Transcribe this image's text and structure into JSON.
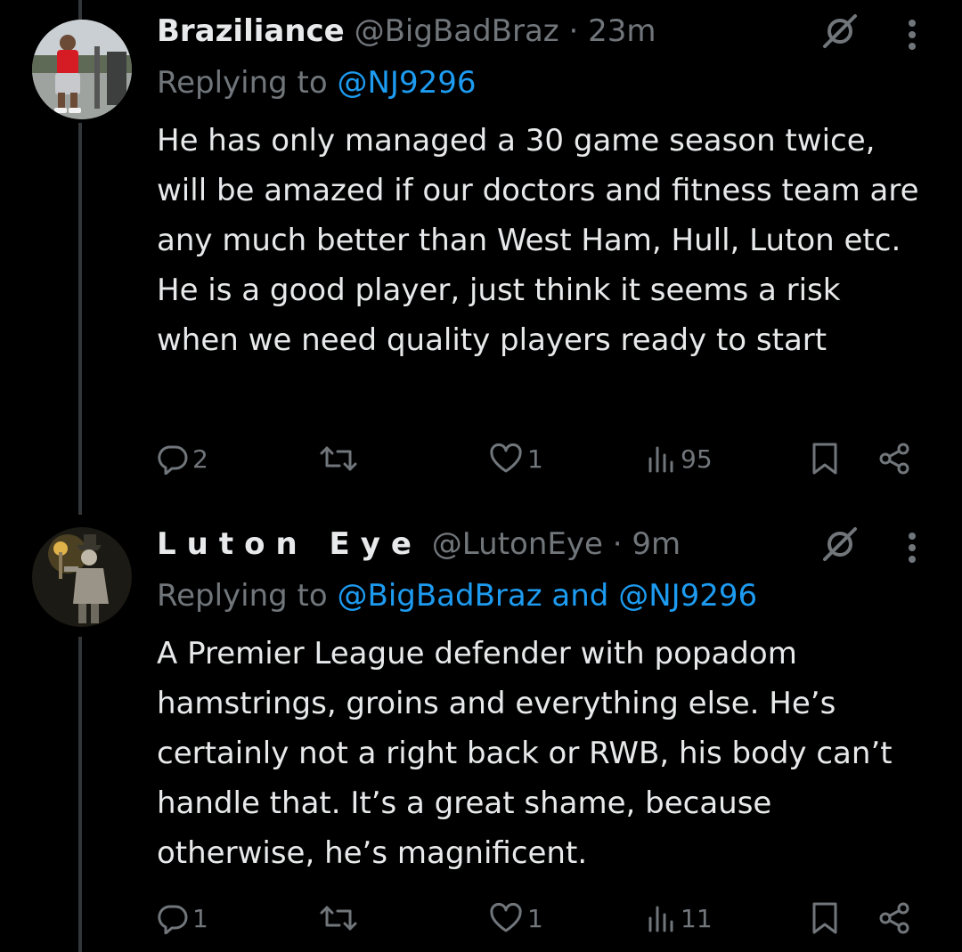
{
  "tweets": [
    {
      "display_name": "Braziliance",
      "handle": "@BigBadBraz",
      "separator": "·",
      "time": "23m",
      "replying_prefix": "Replying to",
      "replying_mentions": [
        "@NJ9296"
      ],
      "replying_joiner": "",
      "text": "He has only managed a 30 game season twice, will be amazed if our doctors and fitness team are any much better than West Ham, Hull, Luton etc. He is a good player, just think it seems a risk when we need quality players ready to start",
      "reply_count": "2",
      "repost_count": "",
      "like_count": "1",
      "view_count": "95"
    },
    {
      "display_name": "Luton Eye",
      "handle": "@LutonEye",
      "separator": "·",
      "time": "9m",
      "replying_prefix": "Replying to",
      "replying_mentions": [
        "@BigBadBraz",
        "@NJ9296"
      ],
      "replying_joiner": "and",
      "text": "A Premier League defender with popadom hamstrings, groins and everything else. He’s certainly not a right back or RWB, his body can’t handle that. It’s a great shame, because otherwise, he’s magnificent.",
      "reply_count": "1",
      "repost_count": "",
      "like_count": "1",
      "view_count": "11"
    }
  ],
  "icons": {
    "reply": "reply-icon",
    "repost": "repost-icon",
    "like": "like-icon",
    "views": "views-icon",
    "bookmark": "bookmark-icon",
    "share": "share-icon",
    "grok": "slash-icon",
    "more": "more-icon"
  },
  "colors": {
    "background": "#000000",
    "text": "#e7e9ea",
    "secondary": "#71767b",
    "mention": "#1d9bf0",
    "thread_line": "#333639"
  }
}
